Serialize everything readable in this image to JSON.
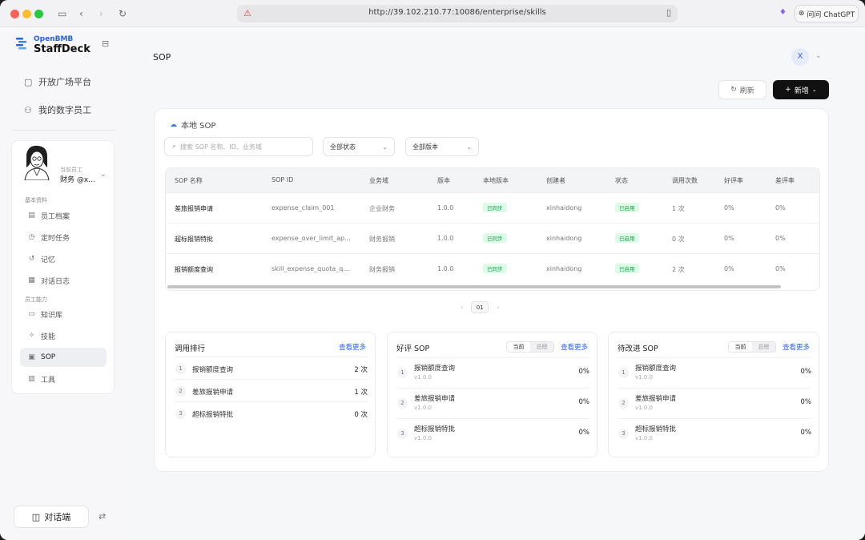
{
  "browser": {
    "url": "http://39.102.210.77:10086/enterprise/skills",
    "chatgpt_label": "问问 ChatGPT"
  },
  "sidebar": {
    "brand_small": "OpenBMB",
    "brand_name": "StaffDeck",
    "top_nav": [
      {
        "label": "开放广场平台",
        "icon": "grid-icon"
      },
      {
        "label": "我的数字员工",
        "icon": "user-group-icon"
      }
    ],
    "employee": {
      "label": "当前员工",
      "name": "财务 @x..."
    },
    "section_basic": "基本资料",
    "basic_items": [
      {
        "label": "员工档案",
        "icon": "id-card-icon"
      },
      {
        "label": "定时任务",
        "icon": "clock-icon"
      },
      {
        "label": "记忆",
        "icon": "history-icon"
      },
      {
        "label": "对话日志",
        "icon": "calendar-icon"
      }
    ],
    "section_abilities": "员工能力",
    "ability_items": [
      {
        "label": "知识库",
        "icon": "folder-icon",
        "active": false
      },
      {
        "label": "技能",
        "icon": "sparkle-icon",
        "active": false
      },
      {
        "label": "SOP",
        "icon": "clipboard-icon",
        "active": true
      },
      {
        "label": "工具",
        "icon": "toolbox-icon",
        "active": false
      }
    ],
    "chat_button": "对话端"
  },
  "header": {
    "title": "SOP",
    "user_initial": "X",
    "refresh_label": "刷新",
    "add_label": "新增"
  },
  "panel": {
    "title": "本地 SOP",
    "search_placeholder": "搜索 SOP 名称、ID、业务域",
    "status_filter": "全部状态",
    "version_filter": "全部版本",
    "columns": [
      "SOP 名称",
      "SOP ID",
      "业务域",
      "版本",
      "本地版本",
      "创建者",
      "状态",
      "调用次数",
      "好评率",
      "差评率"
    ],
    "rows": [
      {
        "name": "差旅报销申请",
        "id": "expense_claim_001",
        "domain": "企业财务",
        "version": "1.0.0",
        "local": "已同步",
        "creator": "xinhaidong",
        "status": "已启用",
        "calls": "1 次",
        "good": "0%",
        "bad": "0%"
      },
      {
        "name": "超标报销特批",
        "id": "expense_over_limit_ap...",
        "domain": "财务报销",
        "version": "1.0.0",
        "local": "已同步",
        "creator": "xinhaidong",
        "status": "已启用",
        "calls": "0 次",
        "good": "0%",
        "bad": "0%"
      },
      {
        "name": "报销额度查询",
        "id": "skill_expense_quota_q...",
        "domain": "财务报销",
        "version": "1.0.0",
        "local": "已同步",
        "creator": "xinhaidong",
        "status": "已启用",
        "calls": "2 次",
        "good": "0%",
        "bad": "0%"
      }
    ],
    "page": "01"
  },
  "cards": {
    "usage": {
      "title": "调用排行",
      "more": "查看更多",
      "items": [
        {
          "rank": "1",
          "name": "报销额度查询",
          "value": "2 次"
        },
        {
          "rank": "2",
          "name": "差旅报销申请",
          "value": "1 次"
        },
        {
          "rank": "3",
          "name": "超标报销特批",
          "value": "0 次"
        }
      ]
    },
    "good": {
      "title": "好评 SOP",
      "toggle_current": "当前",
      "toggle_total": "总榜",
      "more": "查看更多",
      "items": [
        {
          "rank": "1",
          "name": "报销额度查询",
          "ver": "v1.0.0",
          "value": "0%"
        },
        {
          "rank": "2",
          "name": "差旅报销申请",
          "ver": "v1.0.0",
          "value": "0%"
        },
        {
          "rank": "3",
          "name": "超标报销特批",
          "ver": "v1.0.0",
          "value": "0%"
        }
      ]
    },
    "improve": {
      "title": "待改进 SOP",
      "toggle_current": "当前",
      "toggle_total": "总榜",
      "more": "查看更多",
      "items": [
        {
          "rank": "1",
          "name": "报销额度查询",
          "ver": "v1.0.0",
          "value": "0%"
        },
        {
          "rank": "2",
          "name": "差旅报销申请",
          "ver": "v1.0.0",
          "value": "0%"
        },
        {
          "rank": "3",
          "name": "超标报销特批",
          "ver": "v1.0.0",
          "value": "0%"
        }
      ]
    }
  },
  "colors": {
    "accent": "#2563eb",
    "success": "#16a34a",
    "primary_button": "#111111"
  }
}
